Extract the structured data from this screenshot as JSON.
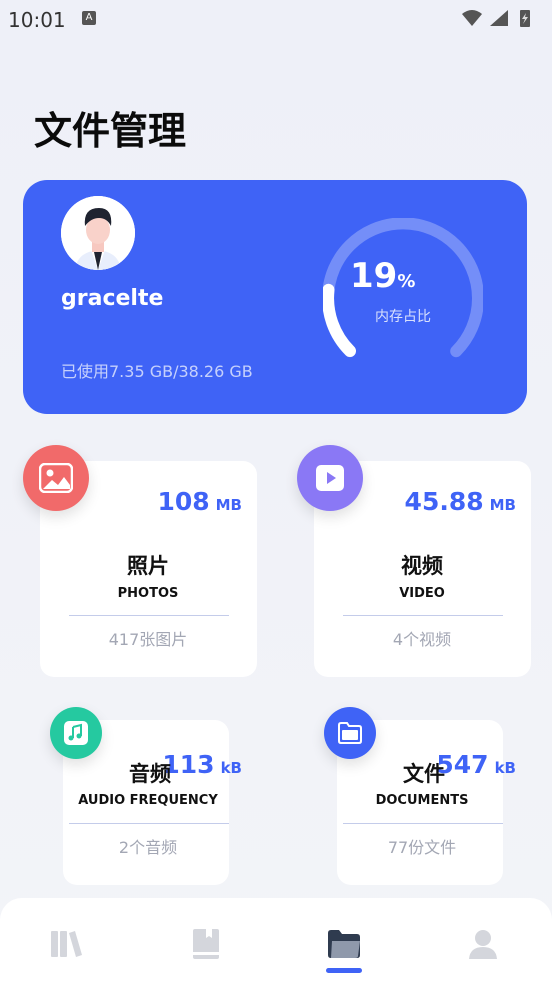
{
  "status_bar": {
    "time": "10:01",
    "notification_badge": "A",
    "icons": [
      "wifi-icon",
      "signal-icon",
      "battery-icon"
    ]
  },
  "page": {
    "title": "文件管理"
  },
  "storage": {
    "username": "gracelte",
    "used_text": "已使用7.35 GB/38.26 GB",
    "percent_value": "19",
    "percent_unit": "%",
    "percent_fraction": 0.19,
    "ring_label": "内存占比",
    "accent_color": "#3f63f6"
  },
  "categories": {
    "photos": {
      "icon": "image-icon",
      "size_value": "108",
      "size_unit": "MB",
      "title": "照片",
      "subtitle": "PHOTOS",
      "count": "417张图片",
      "color": "#f16a6a"
    },
    "video": {
      "icon": "play-icon",
      "size_value": "45.88",
      "size_unit": "MB",
      "title": "视频",
      "subtitle": "VIDEO",
      "count": "4个视频",
      "color": "#8a78f5"
    },
    "audio": {
      "icon": "music-note-icon",
      "size_value": "113",
      "size_unit": "kB",
      "title": "音频",
      "subtitle": "AUDIO FREQUENCY",
      "count": "2个音频",
      "color": "#25c9a0"
    },
    "documents": {
      "icon": "folder-icon",
      "size_value": "547",
      "size_unit": "kB",
      "title": "文件",
      "subtitle": "DOCUMENTS",
      "count": "77份文件",
      "color": "#3f63f6"
    }
  },
  "bottom_nav": {
    "items": [
      {
        "icon": "library-icon",
        "active": false
      },
      {
        "icon": "book-icon",
        "active": false
      },
      {
        "icon": "folder-icon",
        "active": true
      },
      {
        "icon": "user-icon",
        "active": false
      }
    ]
  }
}
